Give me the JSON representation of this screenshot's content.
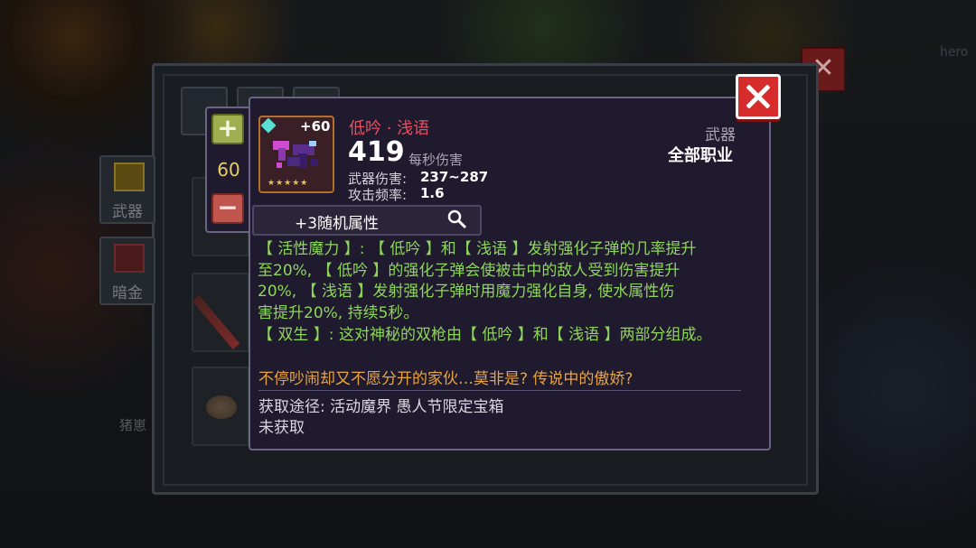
{
  "background": {
    "hero_tag": "hero",
    "side_label": "猪崽",
    "categories": [
      {
        "label": "武器"
      },
      {
        "label": "暗金"
      }
    ]
  },
  "item": {
    "name": "低吟 · 浅语",
    "upgrade_level": "+60",
    "stars": "★★★★★",
    "dps_value": "419",
    "dps_label": "每秒伤害",
    "damage_label": "武器伤害:",
    "damage_value": "237~287",
    "rate_label": "攻击频率:",
    "rate_value": "1.6",
    "category": "武器",
    "class_requirement": "全部职业",
    "random_attributes": "+3随机属性",
    "description_lines": [
      "【 活性魔力 】: 【 低吟 】和【 浅语 】发射强化子弹的几率提升",
      "至20%, 【 低吟 】的强化子弹会使被击中的敌人受到伤害提升",
      "20%, 【 浅语 】发射强化子弹时用魔力强化自身, 使水属性伤",
      "害提升20%, 持续5秒。",
      "【 双生 】: 这对神秘的双枪由【 低吟 】和【 浅语 】两部分组成。"
    ],
    "flavor_text": "不停吵闹却又不愿分开的家伙…莫非是? 传说中的傲娇?",
    "source": "获取途径: 活动魔界 愚人节限定宝箱",
    "obtain_status": "未获取"
  },
  "level_stepper": {
    "plus": "+",
    "value": "60",
    "minus": "−"
  },
  "colors": {
    "name": "#ee4e5e",
    "description": "#8ed65a",
    "flavor": "#e8a43e",
    "close_button": "#d62c2c",
    "level": "#e7cf66"
  }
}
